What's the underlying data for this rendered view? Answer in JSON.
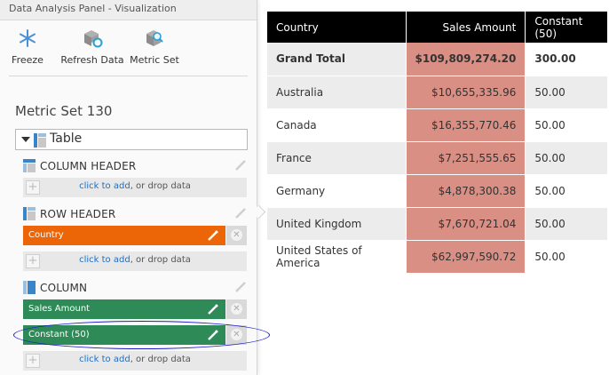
{
  "panel": {
    "title": "Data Analysis Panel - Visualization",
    "toolbar": {
      "freeze": "Freeze",
      "refresh": "Refresh Data",
      "metric_set": "Metric Set"
    },
    "metric_set_name": "Metric Set 130",
    "visual_type": "Table",
    "column_header": {
      "title": "COLUMN HEADER",
      "dropzone_link": "click to add",
      "dropzone_text": ", or drop data"
    },
    "row_header": {
      "title": "ROW HEADER",
      "fields": [
        "Country"
      ],
      "dropzone_link": "click to add",
      "dropzone_text": ", or drop data"
    },
    "column": {
      "title": "COLUMN",
      "fields": [
        "Sales Amount",
        "Constant (50)"
      ],
      "dropzone_link": "click to add",
      "dropzone_text": ", or drop data"
    }
  },
  "colors": {
    "row_field": "#ec6608",
    "column_field": "#2e8b57",
    "sales_cell": "#d98f84",
    "annotation": "#1c1cc8"
  },
  "table": {
    "headers": [
      "Country",
      "Sales Amount",
      "Constant (50)"
    ],
    "total": [
      "Grand Total",
      "$109,809,274.20",
      "300.00"
    ],
    "rows": [
      [
        "Australia",
        "$10,655,335.96",
        "50.00"
      ],
      [
        "Canada",
        "$16,355,770.46",
        "50.00"
      ],
      [
        "France",
        "$7,251,555.65",
        "50.00"
      ],
      [
        "Germany",
        "$4,878,300.38",
        "50.00"
      ],
      [
        "United Kingdom",
        "$7,670,721.04",
        "50.00"
      ],
      [
        "United States of America",
        "$62,997,590.72",
        "50.00"
      ]
    ]
  }
}
